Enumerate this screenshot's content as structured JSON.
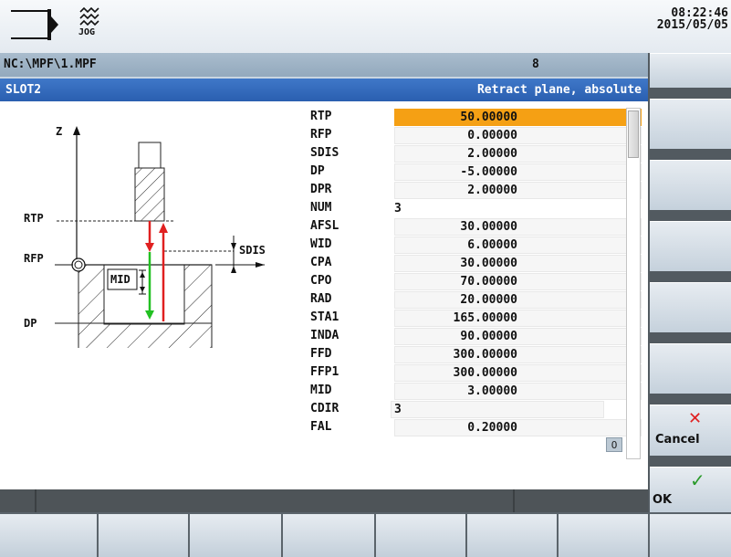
{
  "header": {
    "mode_icon": "machine-area-icon",
    "jog_icon": "jog-mode-icon",
    "jog_label": "JOG",
    "time": "08:22:46",
    "date": "2015/05/05"
  },
  "path": {
    "file": "NC:\\MPF\\1.MPF",
    "number": "8"
  },
  "title": {
    "left": "SLOT2",
    "right": "Retract plane, absolute"
  },
  "diagram": {
    "z_label": "Z",
    "rtp_label": "RTP",
    "rfp_label": "RFP",
    "dp_label": "DP",
    "mid_label": "MID",
    "sdis_label": "SDIS"
  },
  "params": [
    {
      "label": "RTP",
      "value": "50.00000"
    },
    {
      "label": "RFP",
      "value": "0.00000"
    },
    {
      "label": "SDIS",
      "value": "2.00000"
    },
    {
      "label": "DP",
      "value": "-5.00000"
    },
    {
      "label": "DPR",
      "value": "2.00000"
    },
    {
      "label": "NUM",
      "value": "3"
    },
    {
      "label": "AFSL",
      "value": "30.00000"
    },
    {
      "label": "WID",
      "value": "6.00000"
    },
    {
      "label": "CPA",
      "value": "30.00000"
    },
    {
      "label": "CPO",
      "value": "70.00000"
    },
    {
      "label": "RAD",
      "value": "20.00000"
    },
    {
      "label": "STA1",
      "value": "165.00000"
    },
    {
      "label": "INDA",
      "value": "90.00000"
    },
    {
      "label": "FFD",
      "value": "300.00000"
    },
    {
      "label": "FFP1",
      "value": "300.00000"
    },
    {
      "label": "MID",
      "value": "3.00000"
    },
    {
      "label": "CDIR",
      "value": "3"
    },
    {
      "label": "FAL",
      "value": "0.20000"
    }
  ],
  "cdir_toggle": "O",
  "softkeys": {
    "cancel_label": "Cancel",
    "ok_label": "OK"
  },
  "colors": {
    "active_field": "#f5a014",
    "title_bar": "#2f66b7",
    "cancel_icon": "#e02020",
    "ok_icon": "#2a9a2a"
  }
}
